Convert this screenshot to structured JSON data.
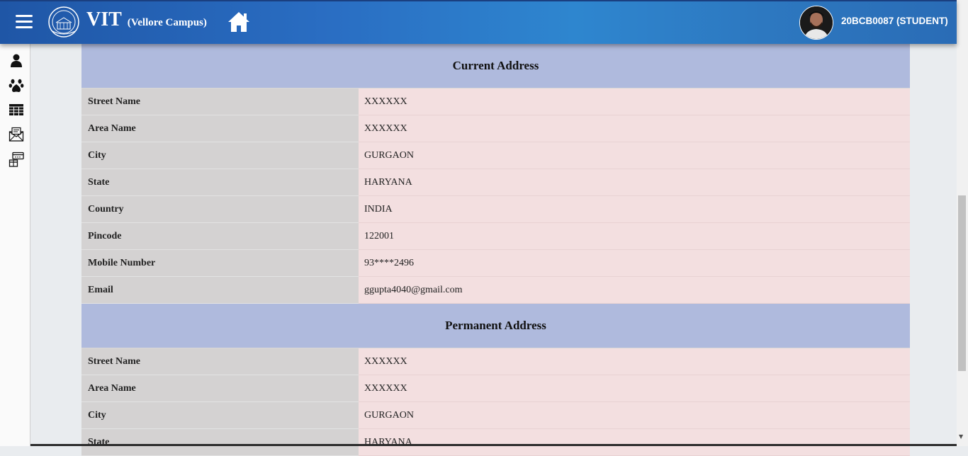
{
  "header": {
    "brand": "VIT",
    "campus": "(Vellore Campus)",
    "user": "20BCB0087 (STUDENT)"
  },
  "sidebar": {
    "icons": [
      "user-icon",
      "paw-icon",
      "table-icon",
      "mail-icon",
      "payment-icon"
    ]
  },
  "current_address": {
    "title": "Current Address",
    "rows": [
      {
        "label": "Street Name",
        "value": "XXXXXX"
      },
      {
        "label": "Area Name",
        "value": "XXXXXX"
      },
      {
        "label": "City",
        "value": "GURGAON"
      },
      {
        "label": "State",
        "value": "HARYANA"
      },
      {
        "label": "Country",
        "value": "INDIA"
      },
      {
        "label": "Pincode",
        "value": "122001"
      },
      {
        "label": "Mobile Number",
        "value": "93****2496"
      },
      {
        "label": "Email",
        "value": "ggupta4040@gmail.com"
      }
    ]
  },
  "permanent_address": {
    "title": "Permanent Address",
    "rows": [
      {
        "label": "Street Name",
        "value": "XXXXXX"
      },
      {
        "label": "Area Name",
        "value": "XXXXXX"
      },
      {
        "label": "City",
        "value": "GURGAON"
      },
      {
        "label": "State",
        "value": "HARYANA"
      }
    ]
  },
  "colors": {
    "header_gradient_start": "#1f56a6",
    "header_gradient_mid": "#2e86cf",
    "section_header": "#afbadd",
    "label_cell": "#d4d2d2",
    "value_cell": "#f3dfe0"
  }
}
